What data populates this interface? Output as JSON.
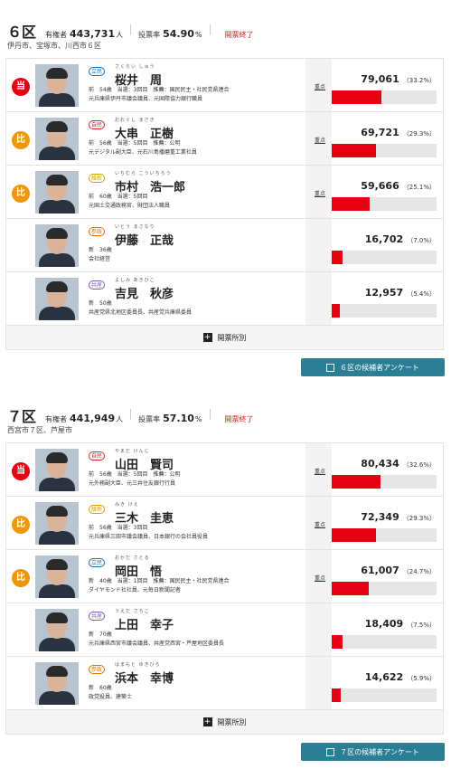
{
  "districts": [
    {
      "name": "６区",
      "voters_label": "有権者",
      "voters": "443,731",
      "voters_unit": "人",
      "turnout_label": "投票率",
      "turnout": "54.90",
      "turnout_unit": "%",
      "status": "開票終了",
      "areas": "伊丹市、宝塚市、川西市６区",
      "tally_label": "開票所別",
      "survey_label": "６区の候補者アンケート",
      "candidates": [
        {
          "badge": "当",
          "badge_type": "win",
          "party": "立民",
          "party_color": "#1a6fb5",
          "furigana": "さくらい しゅう",
          "name": "桜井　周",
          "info": [
            "前　54歳　当選：3回目　推薦：国民民主・社民党県連合",
            "元兵庫県伊丹市議会議員、元国際協力銀行職員"
          ],
          "detail_label": "重点",
          "votes": "79,061",
          "pct": "（33.2%）",
          "share": 0.332
        },
        {
          "badge": "比",
          "badge_type": "pr",
          "party": "自民",
          "party_color": "#d22",
          "furigana": "おおぐし まさき",
          "name": "大串　正樹",
          "info": [
            "前　56歳　当選：5回目　推薦：公明",
            "元デジタル副大臣、元石川島播磨重工業社員"
          ],
          "detail_label": "重点",
          "votes": "69,721",
          "pct": "（29.3%）",
          "share": 0.293
        },
        {
          "badge": "比",
          "badge_type": "pr",
          "party": "維新",
          "party_color": "#d8a000",
          "furigana": "いちむら こういちろう",
          "name": "市村　浩一郎",
          "info": [
            "前　60歳　当選：5回目",
            "元国土交通政務官、財団法人職員"
          ],
          "detail_label": "重点",
          "votes": "59,666",
          "pct": "（25.1%）",
          "share": 0.251
        },
        {
          "badge": "",
          "badge_type": "",
          "party": "参政",
          "party_color": "#e07800",
          "furigana": "いとう まさなり",
          "name": "伊藤　正哉",
          "info": [
            "新　36歳",
            "会社経営"
          ],
          "detail_label": "",
          "votes": "16,702",
          "pct": "（7.0%）",
          "share": 0.07
        },
        {
          "badge": "",
          "badge_type": "",
          "party": "共産",
          "party_color": "#7b5cb0",
          "furigana": "よしみ あきひこ",
          "name": "吉見　秋彦",
          "info": [
            "新　50歳",
            "共産党県北地区委員長、共産党兵庫県委員"
          ],
          "detail_label": "",
          "votes": "12,957",
          "pct": "（5.4%）",
          "share": 0.054
        }
      ]
    },
    {
      "name": "７区",
      "voters_label": "有権者",
      "voters": "441,949",
      "voters_unit": "人",
      "turnout_label": "投票率",
      "turnout": "57.10",
      "turnout_unit": "%",
      "status": "開票終了",
      "areas": "西宮市７区、芦屋市",
      "tally_label": "開票所別",
      "survey_label": "７区の候補者アンケート",
      "candidates": [
        {
          "badge": "当",
          "badge_type": "win",
          "party": "自民",
          "party_color": "#d22",
          "furigana": "やまだ けんじ",
          "name": "山田　賢司",
          "info": [
            "前　56歳　当選：5回目　推薦：公明",
            "元外務副大臣、元三井住友銀行行員"
          ],
          "detail_label": "重点",
          "votes": "80,434",
          "pct": "（32.6%）",
          "share": 0.326
        },
        {
          "badge": "比",
          "badge_type": "pr",
          "party": "維新",
          "party_color": "#d8a000",
          "furigana": "みき けえ",
          "name": "三木　圭恵",
          "info": [
            "前　56歳　当選：3回目",
            "元兵庫県三田市議会議員、日本銀行の会社員役員"
          ],
          "detail_label": "重点",
          "votes": "72,349",
          "pct": "（29.3%）",
          "share": 0.293
        },
        {
          "badge": "比",
          "badge_type": "pr",
          "party": "立民",
          "party_color": "#1a6fb5",
          "furigana": "おかだ さとる",
          "name": "岡田　悟",
          "info": [
            "新　40歳　当選：1回目　推薦：国民民主・社民党県連合",
            "ダイヤモンド社社員、元毎日新聞記者"
          ],
          "detail_label": "重点",
          "votes": "61,007",
          "pct": "（24.7%）",
          "share": 0.247
        },
        {
          "badge": "",
          "badge_type": "",
          "party": "共産",
          "party_color": "#7b5cb0",
          "furigana": "うえだ さちこ",
          "name": "上田　幸子",
          "info": [
            "新　70歳",
            "元兵庫県西宮市議会議員、共産党西宮・芦屋地区委員長"
          ],
          "detail_label": "",
          "votes": "18,409",
          "pct": "（7.5%）",
          "share": 0.075
        },
        {
          "badge": "",
          "badge_type": "",
          "party": "参政",
          "party_color": "#e07800",
          "furigana": "はまもと ゆきひろ",
          "name": "浜本　幸博",
          "info": [
            "新　60歳",
            "政党役員、建築士"
          ],
          "detail_label": "",
          "votes": "14,622",
          "pct": "（5.9%）",
          "share": 0.059
        }
      ]
    }
  ]
}
